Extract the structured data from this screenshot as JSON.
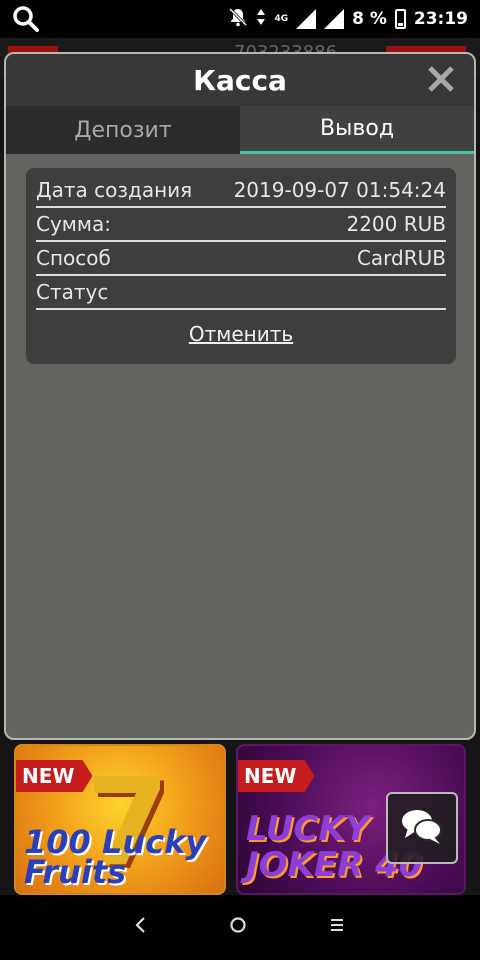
{
  "status_bar": {
    "battery": "8 %",
    "network": "4G",
    "time": "23:19"
  },
  "background": {
    "account_number": "703233886",
    "games": [
      {
        "badge": "NEW",
        "title": "100 Lucky Fruits"
      },
      {
        "badge": "NEW",
        "title": "LUCKY JOKER 40"
      }
    ]
  },
  "modal": {
    "title": "Касса",
    "tabs": [
      {
        "label": "Депозит",
        "active": false
      },
      {
        "label": "Вывод",
        "active": true
      }
    ],
    "withdrawal": {
      "rows": [
        {
          "label": "Дата создания",
          "value": "2019-09-07 01:54:24"
        },
        {
          "label": "Сумма:",
          "value": "2200 RUB"
        },
        {
          "label": "Способ",
          "value": "CardRUB"
        },
        {
          "label": "Статус",
          "value": ""
        }
      ],
      "cancel_label": "Отменить"
    }
  },
  "colors": {
    "modal_bg": "#636360",
    "header_bg": "#383838",
    "active_tab_underline": "#4bc3a6",
    "badge_red": "#c51d1d"
  },
  "icons": {
    "status_search": "search-icon",
    "status_bell_off": "bell-off-icon",
    "close": "close-icon",
    "chat": "chat-icon",
    "nav_back": "back-icon",
    "nav_home": "home-icon",
    "nav_menu": "menu-icon"
  }
}
